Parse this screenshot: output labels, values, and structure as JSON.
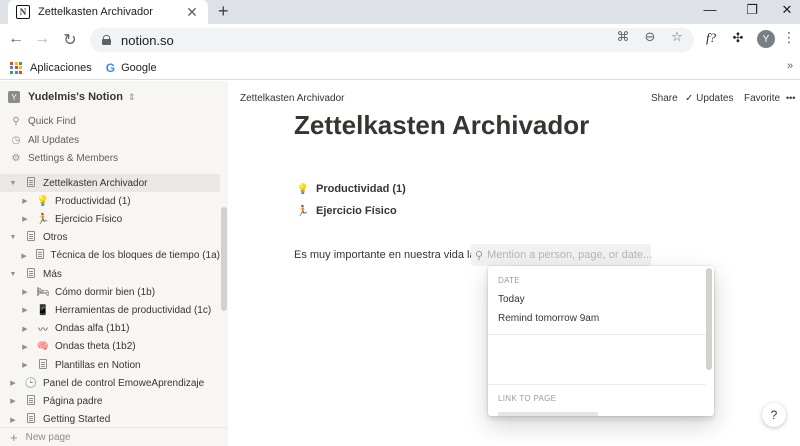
{
  "browser": {
    "tab_title": "Zettelkasten Archivador",
    "tab_favicon": "N",
    "tab_close": "✕",
    "new_tab": "+",
    "window_controls": [
      "—",
      "❐",
      "✕"
    ],
    "url": "notion.so",
    "avatar_letter": "Y",
    "ext_label": "f?",
    "bookmarks": {
      "apps_label": "Aplicaciones",
      "google_label": "Google",
      "more": "»"
    }
  },
  "workspace": {
    "name": "Yudelmis's Notion",
    "icon_letter": "Y"
  },
  "sidebar": {
    "links": [
      {
        "icon": "search-icon",
        "label": "Quick Find"
      },
      {
        "icon": "clock-icon",
        "label": "All Updates"
      },
      {
        "icon": "gear-icon",
        "label": "Settings & Members"
      }
    ],
    "tree": [
      {
        "label": "Zettelkasten Archivador",
        "indent": 0,
        "emoji": "",
        "expanded": true,
        "active": true
      },
      {
        "label": "Productividad (1)",
        "indent": 1,
        "emoji": "💡"
      },
      {
        "label": "Ejercicio Físico",
        "indent": 1,
        "emoji": "🏃"
      },
      {
        "label": "Otros",
        "indent": 0,
        "emoji": "",
        "expanded": true
      },
      {
        "label": "Técnica de los bloques de tiempo (1a)",
        "indent": 1,
        "emoji": ""
      },
      {
        "label": "Más",
        "indent": 0,
        "emoji": "",
        "expanded": true
      },
      {
        "label": "Cómo dormir bien (1b)",
        "indent": 1,
        "emoji": "🛏"
      },
      {
        "label": "Herramientas de productividad (1c)",
        "indent": 1,
        "emoji": "📱"
      },
      {
        "label": "Ondas alfa (1b1)",
        "indent": 1,
        "emoji": "〰"
      },
      {
        "label": "Ondas theta (1b2)",
        "indent": 1,
        "emoji": "🧠"
      },
      {
        "label": "Plantillas en Notion",
        "indent": 1,
        "emoji": ""
      },
      {
        "label": "Panel de control EmoweAprendizaje",
        "indent": 0,
        "emoji": "🕒"
      },
      {
        "label": "Página padre",
        "indent": 0,
        "emoji": ""
      },
      {
        "label": "Getting Started",
        "indent": 0,
        "emoji": ""
      }
    ],
    "new_page": "New page"
  },
  "topbar": {
    "breadcrumb": "Zettelkasten Archivador",
    "share": "Share",
    "updates": "Updates",
    "favorite": "Favorite",
    "more": "•••"
  },
  "page": {
    "title": "Zettelkasten Archivador",
    "children": [
      {
        "emoji": "💡",
        "label": "Productividad (1)"
      },
      {
        "emoji": "🏃",
        "label": "Ejercicio Físico"
      }
    ],
    "paragraph": "Es muy importante en nuestra vida la",
    "mention_placeholder": "Mention a person, page, or date..."
  },
  "popup": {
    "date_header": "DATE",
    "items": [
      "Today",
      "Remind tomorrow 9am"
    ],
    "link_header": "LINK TO PAGE"
  },
  "help": "?",
  "colors": {
    "sidebar_bg": "#f7f6f3",
    "text": "#37352f",
    "chrome_tabbar": "#dee1e6"
  }
}
